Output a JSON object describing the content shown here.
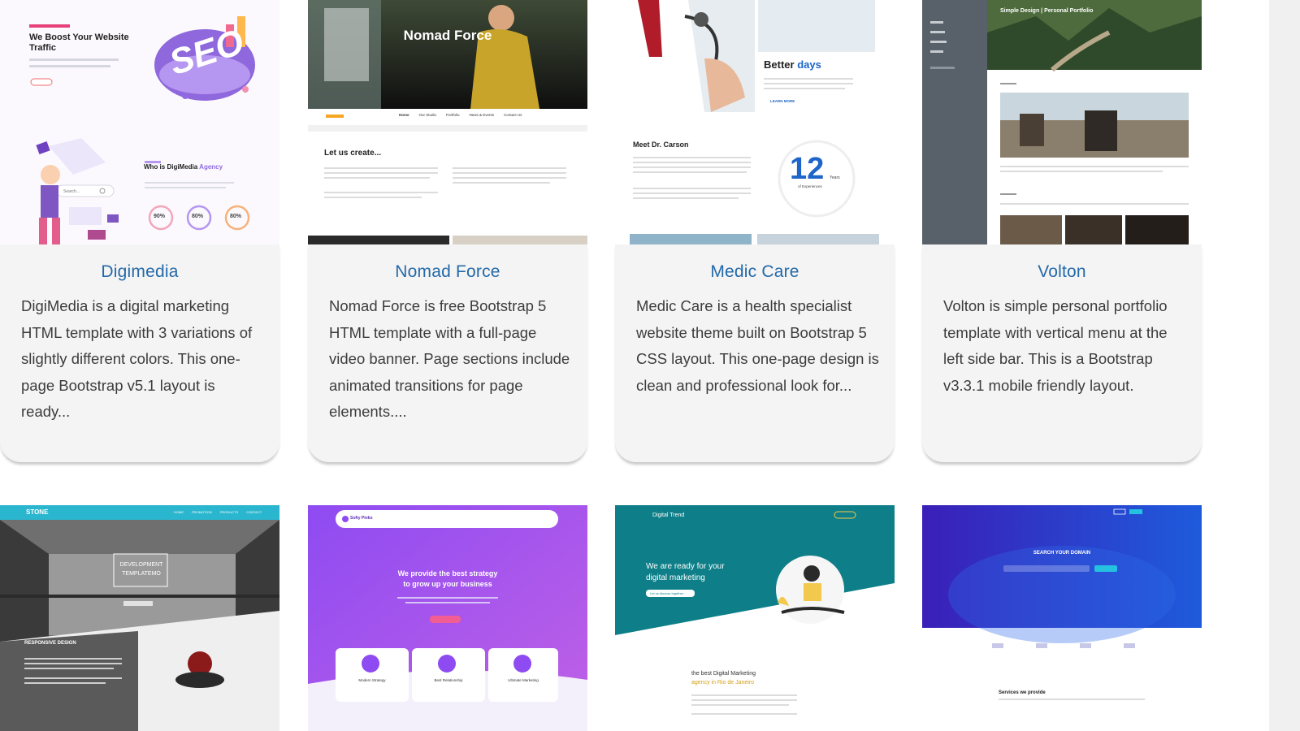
{
  "cards": [
    {
      "title": "Digimedia",
      "description": "DigiMedia is a digital marketing HTML template with 3 variations of slightly different colors. This one-page Bootstrap v5.1 layout is ready...",
      "preview": {
        "headline": "We Boost Your Website Traffic",
        "badge": "SEO",
        "section_title": "Who is DigiMedia",
        "section_accent": "Agency",
        "search_placeholder": "Search...",
        "stats": [
          "90%",
          "80%",
          "80%"
        ]
      }
    },
    {
      "title": "Nomad Force",
      "description": "Nomad Force is free Bootstrap 5 HTML template with a full-page video banner. Page sections include animated transitions for page elements....",
      "preview": {
        "banner_title": "Nomad Force",
        "nav": [
          "Home",
          "Our Studio",
          "Portfolio",
          "News & Events",
          "Contact Us"
        ],
        "section_title": "Let us create..."
      }
    },
    {
      "title": "Medic Care",
      "description": "Medic Care is a health specialist website theme built on Bootstrap 5 CSS layout. This one-page design is clean and professional look for...",
      "preview": {
        "heading_start": "Better",
        "heading_accent": "days",
        "learn_more": "LEARN MORE",
        "doctor": "Meet Dr. Carson",
        "years_number": "12",
        "years_label": "Years",
        "years_caption": "of Experiences"
      }
    },
    {
      "title": "Volton",
      "description": "Volton is simple personal portfolio template with vertical menu at the left side bar. This is a Bootstrap v3.3.1 mobile friendly layout.",
      "preview": {
        "banner_title": "Simple Design | Personal Portfolio"
      }
    },
    {
      "title": "",
      "description": "",
      "preview": {
        "brand": "STONE",
        "nav": [
          "HOME",
          "PROMOTION",
          "PRODUCTS",
          "CONTACT"
        ],
        "center_box": "DEVELOPMENT TEMPLATEMO",
        "section_title": "RESPONSIVE DESIGN"
      }
    },
    {
      "title": "",
      "description": "",
      "preview": {
        "brand": "Softy Pinko",
        "headline_1": "We provide the best strategy",
        "headline_2": "to grow up your business",
        "features": [
          "Modern Strategy",
          "Best Relationship",
          "Ultimate Marketing"
        ]
      }
    },
    {
      "title": "",
      "description": "",
      "preview": {
        "brand": "Digital Trend",
        "headline_1": "We are ready for your",
        "headline_2": "digital marketing",
        "cta": "Let us discuss together",
        "tagline_1": "the best Digital Marketing",
        "tagline_2": "agency in Rio de Janeiro"
      }
    },
    {
      "title": "",
      "description": "",
      "preview": {
        "search_title": "SEARCH YOUR DOMAIN",
        "services": "Services we provide"
      }
    }
  ]
}
